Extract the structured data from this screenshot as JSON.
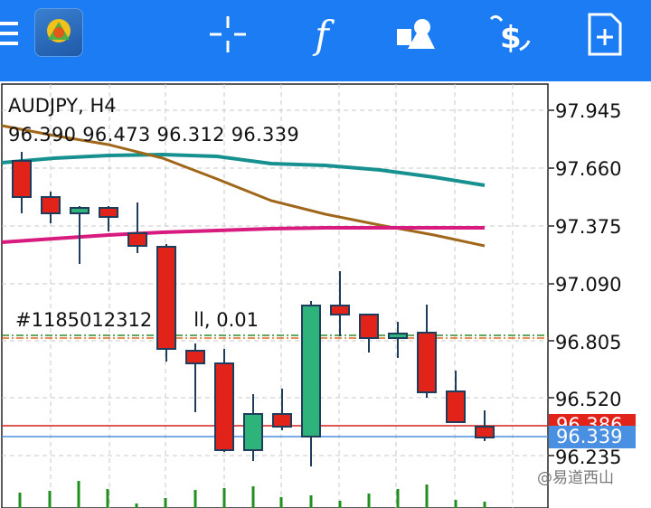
{
  "toolbar": {
    "background": "#1c7cf4",
    "icons": [
      "menu-icon",
      "app-logo-icon",
      "crosshair-icon",
      "indicators-icon",
      "objects-icon",
      "trade-icon",
      "new-order-icon"
    ],
    "indicators_glyph": "f"
  },
  "chart": {
    "symbol": "AUDJPY, H4",
    "ohlc": "96.390 96.473 96.312 96.339",
    "order_line": {
      "id": "#1185012312",
      "suffix": "ll, 0.01"
    },
    "price_axis": [
      "97.945",
      "97.660",
      "97.375",
      "97.090",
      "96.805",
      "96.520",
      "96.235"
    ],
    "bid_badge": "96.386",
    "ask_badge": "96.339",
    "colors": {
      "bull": "#2eb37a",
      "bear": "#e2231a",
      "ma_teal": "#17918f",
      "ma_brown": "#a0671b",
      "ma_magenta": "#d81b7f",
      "bid_line": "#d42020",
      "ask_line": "#4a90e2",
      "volume": "#1f8f1f"
    }
  },
  "watermark": "@易道西山"
}
